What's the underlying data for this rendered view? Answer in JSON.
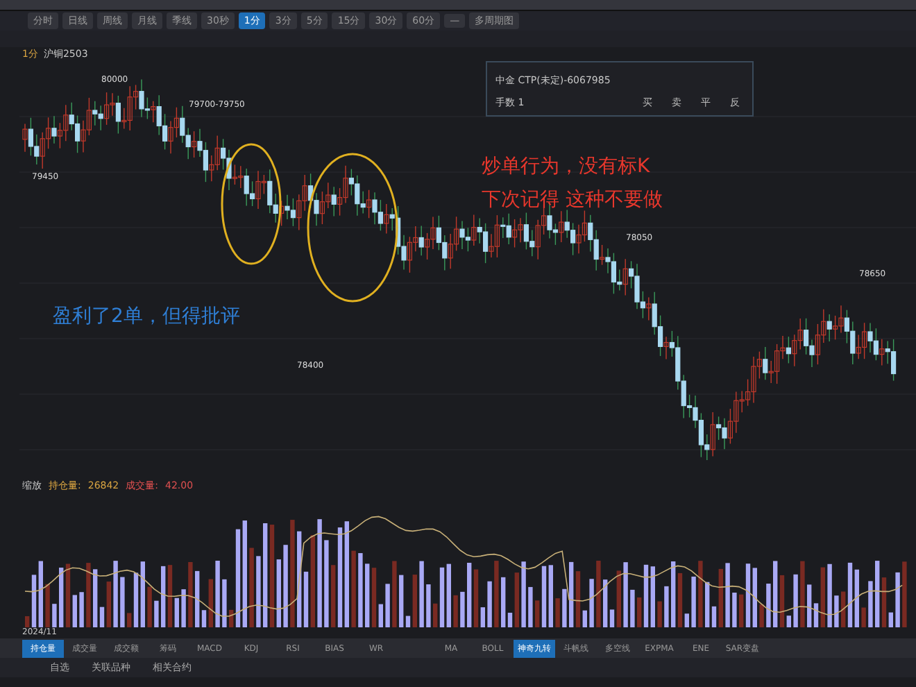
{
  "toolbar": {
    "periods": [
      {
        "label": "分时",
        "selected": false
      },
      {
        "label": "日线",
        "selected": false
      },
      {
        "label": "周线",
        "selected": false
      },
      {
        "label": "月线",
        "selected": false
      },
      {
        "label": "季线",
        "selected": false
      },
      {
        "label": "30秒",
        "selected": false
      },
      {
        "label": "1分",
        "selected": true
      },
      {
        "label": "3分",
        "selected": false
      },
      {
        "label": "5分",
        "selected": false
      },
      {
        "label": "15分",
        "selected": false
      },
      {
        "label": "30分",
        "selected": false
      },
      {
        "label": "60分",
        "selected": false
      },
      {
        "label": "—",
        "selected": false
      },
      {
        "label": "多周期图",
        "selected": false
      }
    ]
  },
  "order_panel": {
    "account": "中金 CTP(未定)-6067985",
    "quantity": "手数 1",
    "actions": [
      "买",
      "卖",
      "平",
      "反"
    ]
  },
  "chart": {
    "period": "1分",
    "symbol": "沪铜2503",
    "price_labels": [
      "80000",
      "79700-79750",
      "79450",
      "78400",
      "78050",
      "78650"
    ],
    "annotations": [
      {
        "text": "炒单行为，没有标K",
        "color": "#e8372c"
      },
      {
        "text": "下次记得 这种不要做",
        "color": "#e8372c"
      },
      {
        "text": "盈利了2单，但得批评",
        "color": "#2f7fd6"
      }
    ]
  },
  "volume_panel": {
    "title": "缩放",
    "legend": [
      {
        "label": "持仓量:",
        "value": "26842"
      },
      {
        "label": "成交量:",
        "value": "42.00"
      }
    ],
    "date": "2024/11"
  },
  "indicator_tabs": [
    {
      "label": "持仓量",
      "selected": true
    },
    {
      "label": "成交量",
      "selected": false
    },
    {
      "label": "成交额",
      "selected": false
    },
    {
      "label": "筹码",
      "selected": false
    },
    {
      "label": "MACD",
      "selected": false
    },
    {
      "label": "KDJ",
      "selected": false
    },
    {
      "label": "RSI",
      "selected": false
    },
    {
      "label": "BIAS",
      "selected": false
    },
    {
      "label": "WR",
      "selected": false
    }
  ],
  "overlay_tabs": [
    {
      "label": "MA",
      "selected": false
    },
    {
      "label": "BOLL",
      "selected": false
    },
    {
      "label": "神奇九转",
      "selected": true
    },
    {
      "label": "斗帆线",
      "selected": false
    },
    {
      "label": "多空线",
      "selected": false
    },
    {
      "label": "EXPMA",
      "selected": false
    },
    {
      "label": "ENE",
      "selected": false
    },
    {
      "label": "SAR变盘",
      "selected": false
    }
  ],
  "bottom_tabs": [
    "自选",
    "关联品种",
    "相关合约"
  ]
}
